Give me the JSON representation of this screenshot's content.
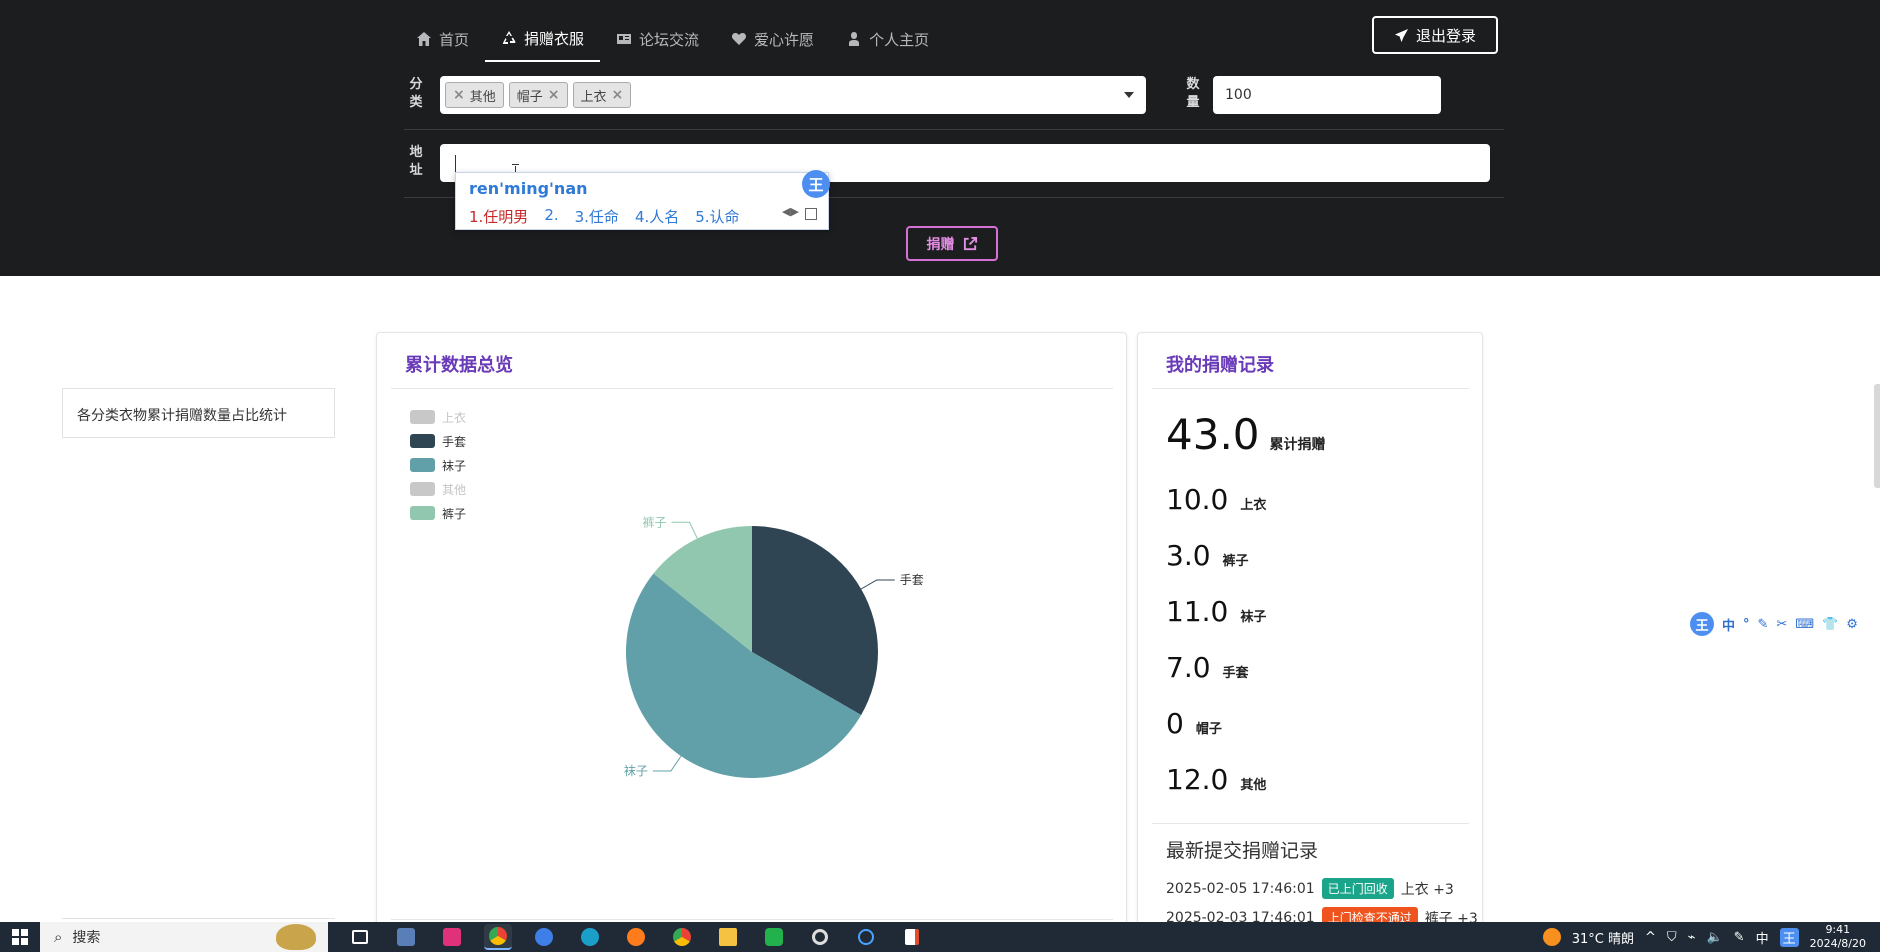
{
  "nav": {
    "items": [
      {
        "label": "首页",
        "icon": "home-icon"
      },
      {
        "label": "捐赠衣服",
        "icon": "recycle-icon",
        "active": true
      },
      {
        "label": "论坛交流",
        "icon": "id-card-icon"
      },
      {
        "label": "爱心许愿",
        "icon": "heart-icon"
      },
      {
        "label": "个人主页",
        "icon": "user-icon"
      }
    ],
    "logout_label": "退出登录"
  },
  "form": {
    "category_label": "分类",
    "category_tags": [
      "其他",
      "帽子",
      "上衣"
    ],
    "quantity_label": "数量",
    "quantity_value": "100",
    "address_label": "地址",
    "address_value": "",
    "submit_label": "捐赠"
  },
  "ime": {
    "pinyin": "ren'ming'nan",
    "candidates": [
      "1.任明男",
      "2.",
      "3.任命",
      "4.人名",
      "5.认命"
    ],
    "badge": "王"
  },
  "side": {
    "menu_item": "各分类衣物累计捐赠数量占比统计"
  },
  "overview": {
    "title": "累计数据总览"
  },
  "chart_data": {
    "type": "pie",
    "title": "",
    "legend": [
      {
        "name": "上衣",
        "enabled": false,
        "color": "#c8c8c8"
      },
      {
        "name": "手套",
        "enabled": true,
        "color": "#2f4554"
      },
      {
        "name": "袜子",
        "enabled": true,
        "color": "#61a0a8"
      },
      {
        "name": "其他",
        "enabled": false,
        "color": "#c8c8c8"
      },
      {
        "name": "裤子",
        "enabled": true,
        "color": "#91c7ae"
      }
    ],
    "slices": [
      {
        "name": "手套",
        "value": 7,
        "color": "#2f4554"
      },
      {
        "name": "袜子",
        "value": 11,
        "color": "#61a0a8"
      },
      {
        "name": "裤子",
        "value": 3,
        "color": "#91c7ae"
      }
    ],
    "legend_position": "top-left"
  },
  "records": {
    "title": "我的捐赠记录",
    "total_value": "43.0",
    "total_label": "累计捐赠",
    "stats": [
      {
        "value": "10.0",
        "label": "上衣"
      },
      {
        "value": "3.0",
        "label": "裤子"
      },
      {
        "value": "11.0",
        "label": "袜子"
      },
      {
        "value": "7.0",
        "label": "手套"
      },
      {
        "value": "0",
        "label": "帽子"
      },
      {
        "value": "12.0",
        "label": "其他"
      }
    ],
    "latest_title": "最新提交捐赠记录",
    "latest": [
      {
        "time": "2025-02-05 17:46:01",
        "status": "已上门回收",
        "status_color": "#1aa58a",
        "item": "上衣 +3"
      },
      {
        "time": "2025-02-03 17:46:01",
        "status": "上门检查不通过",
        "status_color": "#f0541e",
        "item": "裤子 +3"
      }
    ]
  },
  "ime_toolbar": {
    "logo": "王",
    "items": [
      "中",
      "°",
      "✎",
      "✂",
      "⌨",
      "👕",
      "⚙"
    ]
  },
  "taskbar": {
    "search_label": "搜索",
    "weather": "31°C 晴朗",
    "lang": "中",
    "time": "9:41",
    "date": "2024/8/20"
  }
}
